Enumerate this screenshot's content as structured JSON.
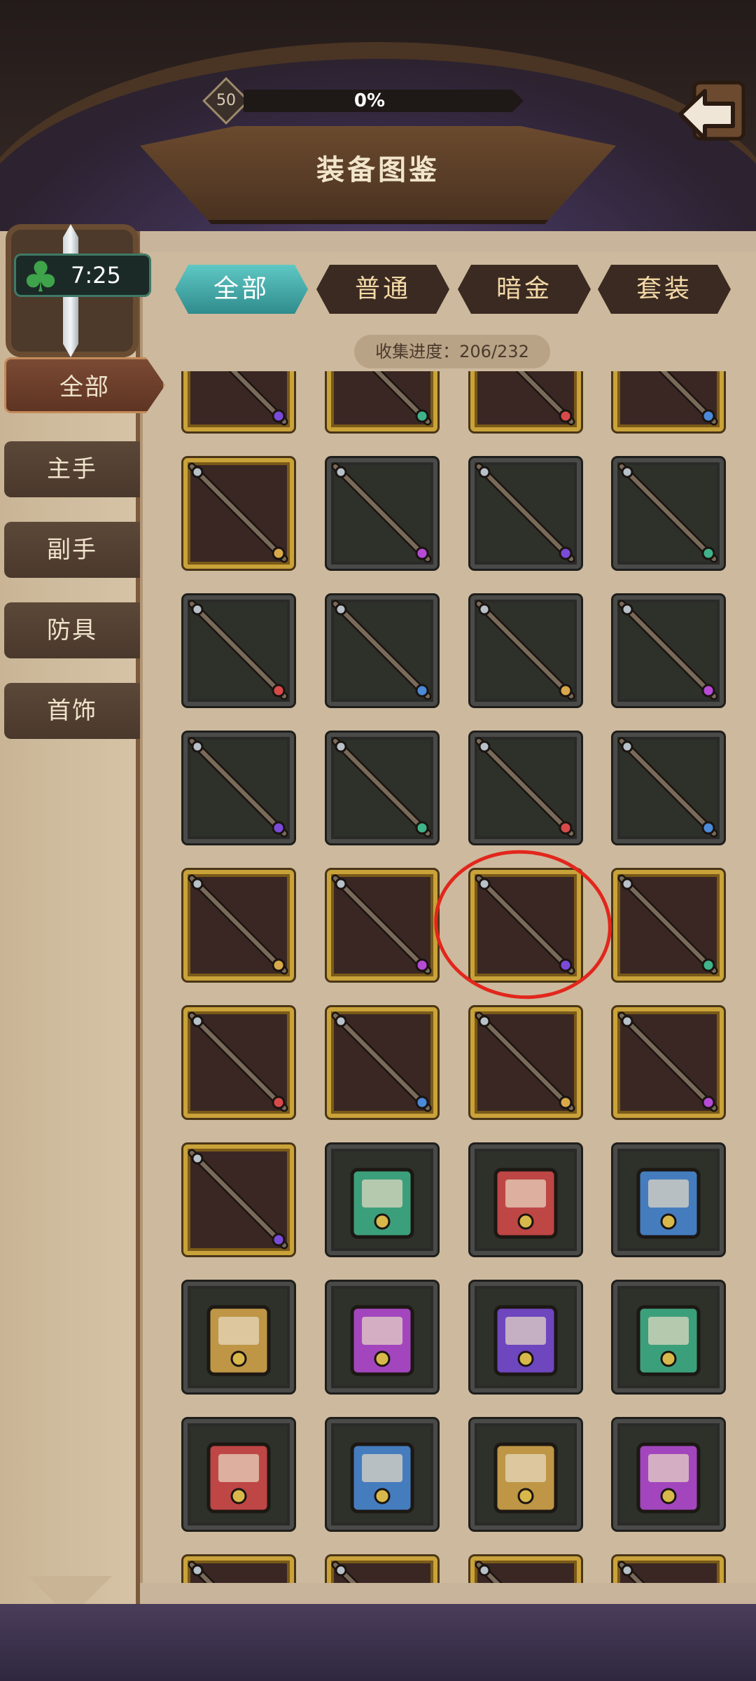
{
  "header": {
    "level": "50",
    "progress_text": "0%",
    "progress_fraction": 0.0,
    "title": "装备图鉴",
    "back_icon": "back-arrow-icon"
  },
  "timer": {
    "icon": "clover-icon",
    "time": "7:25"
  },
  "sidebar": {
    "items": [
      {
        "label": "全部",
        "active": true
      },
      {
        "label": "主手",
        "active": false
      },
      {
        "label": "副手",
        "active": false
      },
      {
        "label": "防具",
        "active": false
      },
      {
        "label": "首饰",
        "active": false
      }
    ]
  },
  "tabs": [
    {
      "label": "全部",
      "active": true
    },
    {
      "label": "普通",
      "active": false
    },
    {
      "label": "暗金",
      "active": false
    },
    {
      "label": "套装",
      "active": false
    }
  ],
  "collection": {
    "text": "收集进度：206/232"
  },
  "colors": {
    "gold_frame": "#c9a23a",
    "normal_frame": "#4a4a48",
    "active_tab": "#3fa9a6",
    "highlight": "#e2261c"
  },
  "grid": {
    "rows": [
      {
        "frame": "gold",
        "items": [
          "staff",
          "staff",
          "staff",
          "staff"
        ]
      },
      {
        "frame": "mixed",
        "items": [
          "scythe-staff",
          "wand",
          "wand",
          "wand"
        ]
      },
      {
        "frame": "normal",
        "items": [
          "crystal-staff",
          "wand",
          "wand",
          "wand"
        ]
      },
      {
        "frame": "normal",
        "items": [
          "vine-staff",
          "wand",
          "wand",
          "wand"
        ]
      },
      {
        "frame": "gold",
        "items": [
          "spear-staff",
          "shadow-blade-staff",
          "dark-branch-staff",
          "thorn-staff"
        ]
      },
      {
        "frame": "gold",
        "items": [
          "eye-staff",
          "wood-staff",
          "rose-staff",
          "dark-wand"
        ]
      },
      {
        "frame": "mixed",
        "items": [
          "hat-staff",
          "scroll",
          "spellbook",
          "crystal-box"
        ]
      },
      {
        "frame": "normal",
        "items": [
          "tool-bag",
          "potion-orb",
          "shield-book",
          "wolf-mask"
        ]
      },
      {
        "frame": "normal",
        "items": [
          "tome-bundle",
          "paper-stack",
          "star-book",
          "leaf-book"
        ]
      },
      {
        "frame": "mixed",
        "items": [
          "item",
          "item",
          "item",
          "item"
        ]
      }
    ]
  }
}
